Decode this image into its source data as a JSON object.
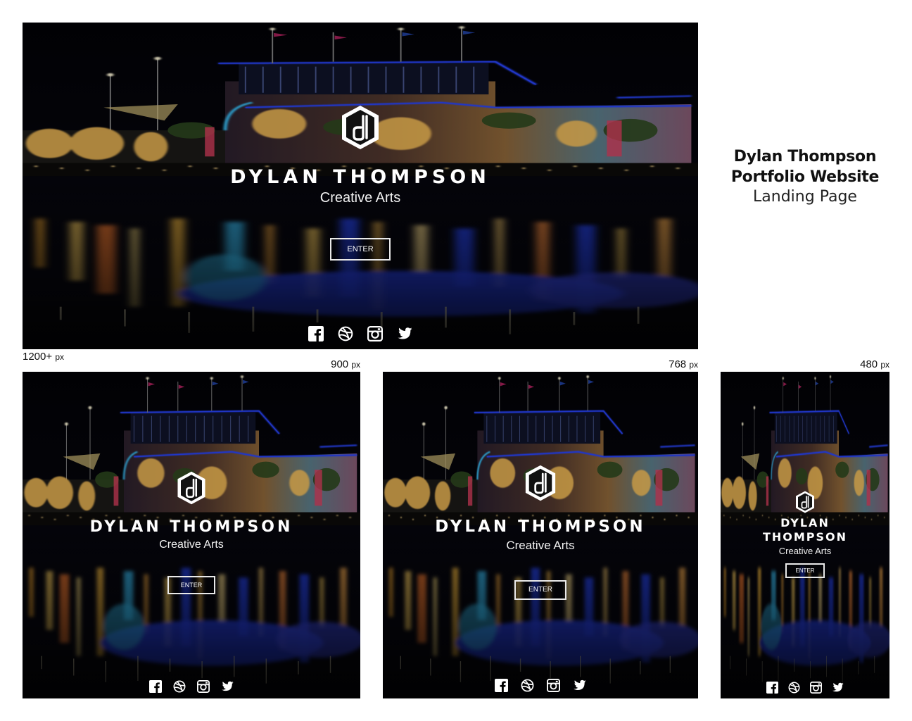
{
  "doc": {
    "title_line1": "Dylan Thompson",
    "title_line2": "Portfolio Website",
    "title_line3": "Landing Page"
  },
  "site": {
    "name": "DYLAN THOMPSON",
    "name_line1": "DYLAN",
    "name_line2": "THOMPSON",
    "tagline": "Creative Arts",
    "enter_label": "ENTER",
    "social": [
      "facebook-icon",
      "dribbble-icon",
      "instagram-icon",
      "twitter-icon"
    ]
  },
  "breakpoints": {
    "large": {
      "value": "1200+",
      "unit": "px"
    },
    "medium": {
      "value": "900",
      "unit": "px"
    },
    "tablet": {
      "value": "768",
      "unit": "px"
    },
    "mobile": {
      "value": "480",
      "unit": "px"
    }
  },
  "colors": {
    "accent_blue": "#2a46ff",
    "neon_cyan": "#39c6ff",
    "light_gold": "#ffc55a",
    "background": "#000000"
  }
}
